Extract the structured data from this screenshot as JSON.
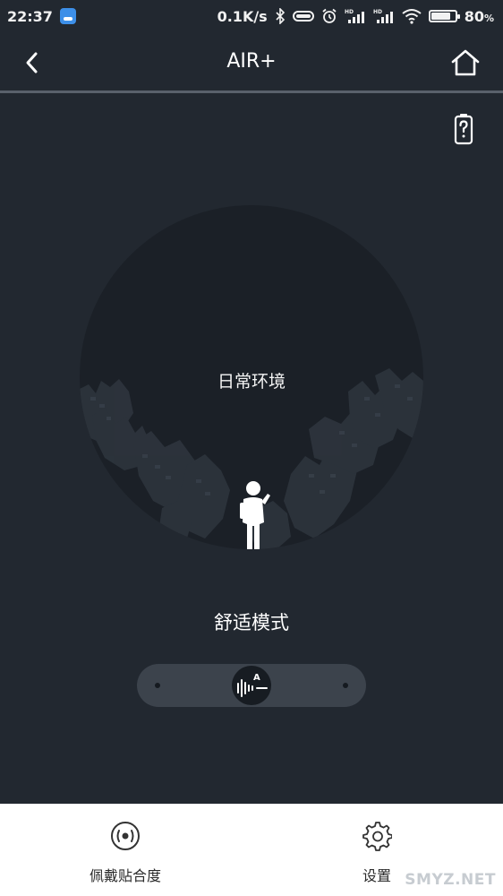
{
  "status_bar": {
    "time": "22:37",
    "network_speed": "0.1K/s",
    "battery_percent": "80",
    "battery_unit": "%",
    "battery_level": 0.8
  },
  "header": {
    "title": "AIR+"
  },
  "environment": {
    "label": "日常环境"
  },
  "mode": {
    "label": "舒适模式"
  },
  "bottom_nav": {
    "items": [
      {
        "label": "佩戴贴合度",
        "icon": "fit-target-icon"
      },
      {
        "label": "设置",
        "icon": "gear-icon"
      }
    ]
  },
  "watermark": {
    "text": "SMYZ.NET"
  },
  "colors": {
    "background": "#222830",
    "circle": "#1b2027",
    "slider_track": "#3c434c",
    "nav_background": "#ffffff"
  }
}
